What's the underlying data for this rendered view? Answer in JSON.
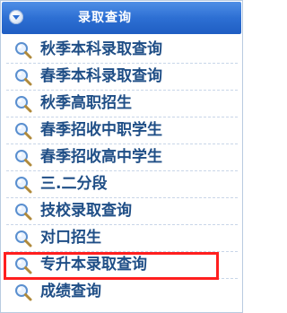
{
  "header": {
    "title": "录取查询",
    "icon": "chevron-down-icon"
  },
  "menu": {
    "items": [
      {
        "label": "秋季本科录取查询",
        "icon": "magnifier-icon",
        "highlighted": false
      },
      {
        "label": "春季本科录取查询",
        "icon": "magnifier-icon",
        "highlighted": false
      },
      {
        "label": "秋季高职招生",
        "icon": "magnifier-icon",
        "highlighted": false
      },
      {
        "label": "春季招收中职学生",
        "icon": "magnifier-icon",
        "highlighted": false
      },
      {
        "label": "春季招收高中学生",
        "icon": "magnifier-icon",
        "highlighted": false
      },
      {
        "label": "三.二分段",
        "icon": "magnifier-icon",
        "highlighted": false
      },
      {
        "label": "技校录取查询",
        "icon": "magnifier-icon",
        "highlighted": false
      },
      {
        "label": "对口招生",
        "icon": "magnifier-icon",
        "highlighted": false
      },
      {
        "label": "专升本录取查询",
        "icon": "magnifier-icon",
        "highlighted": true
      },
      {
        "label": "成绩查询",
        "icon": "magnifier-icon",
        "highlighted": false
      }
    ]
  },
  "colors": {
    "header": "#2d6fd3",
    "text": "#1f4e86",
    "highlight_border": "#ff1f1f",
    "divider": "#c8d6e8"
  }
}
